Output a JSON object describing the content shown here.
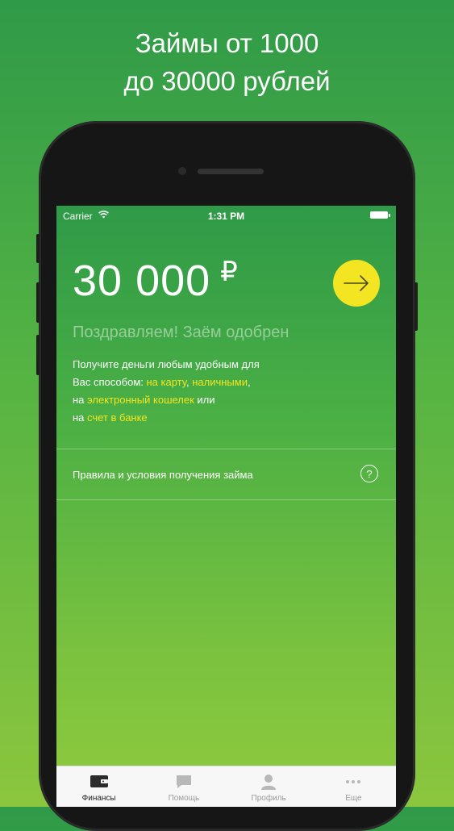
{
  "headline": {
    "line1": "Займы от 1000",
    "line2": "до 30000 рублей"
  },
  "status_bar": {
    "carrier": "Carrier",
    "time": "1:31 PM"
  },
  "loan": {
    "amount": "30 000",
    "currency": "₽",
    "approved_text": "Поздравляем! Заём одобрен",
    "desc": {
      "line1": "Получите деньги любым удобным для",
      "line2_prefix": "Вас способом: ",
      "card": "на карту",
      "comma": ", ",
      "cash": "наличными",
      "line2_end": ",",
      "line3_prefix": "на ",
      "wallet": "электронный кошелек",
      "line3_suffix": " или",
      "line4_prefix": "на ",
      "bank": "счет в банке"
    }
  },
  "rules": {
    "label": "Правила и условия получения займа",
    "help": "?"
  },
  "tabs": [
    {
      "label": "Финансы",
      "icon": "wallet-icon",
      "active": true
    },
    {
      "label": "Помощь",
      "icon": "chat-icon",
      "active": false
    },
    {
      "label": "Профиль",
      "icon": "profile-icon",
      "active": false
    },
    {
      "label": "Еще",
      "icon": "more-icon",
      "active": false
    }
  ],
  "colors": {
    "accent": "#f3e521",
    "green_top": "#2f9a48",
    "green_bottom": "#8fca3d"
  }
}
